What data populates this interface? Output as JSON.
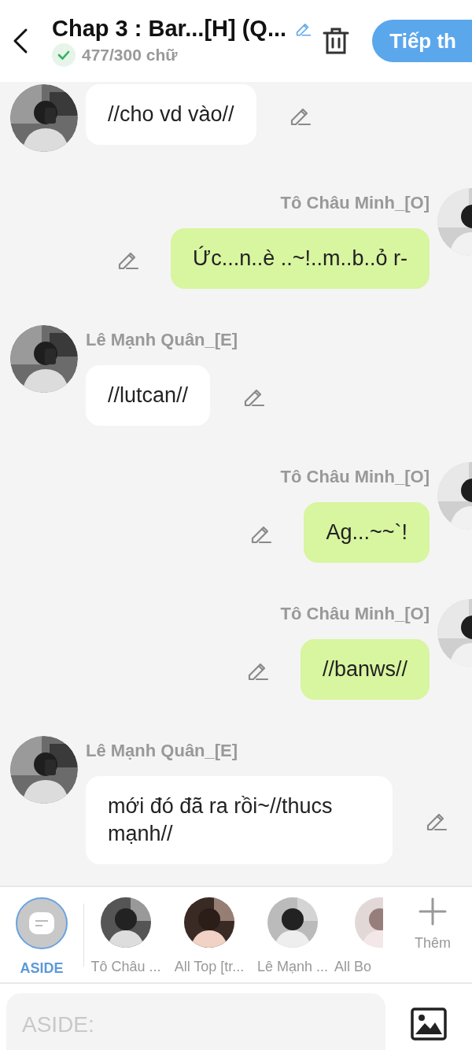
{
  "header": {
    "title": "Chap 3 : Bar...[H] (Q...",
    "word_count": "477/300 chữ",
    "next_button": "Tiếp th"
  },
  "messages": [
    {
      "kind": "incoming",
      "text": "//cho vd vào//"
    },
    {
      "kind": "outgoing",
      "name": "Tô Châu Minh_[O]",
      "text": "Ức...n..è ..~!..m..b..ỏ r-"
    },
    {
      "kind": "incoming",
      "name": "Lê Mạnh Quân_[E]",
      "text": "//lutcan//"
    },
    {
      "kind": "outgoing",
      "name": "Tô Châu Minh_[O]",
      "text": "Ag...~~`!"
    },
    {
      "kind": "outgoing",
      "name": "Tô Châu Minh_[O]",
      "text": "//banws//"
    },
    {
      "kind": "incoming",
      "name": "Lê Mạnh Quân_[E]",
      "text": "mới đó đã ra rồi~//thucs mạnh//"
    }
  ],
  "cast": [
    {
      "kind": "aside",
      "label": "ASIDE",
      "selected": true
    },
    {
      "kind": "character",
      "label": "Tô Châu ...",
      "selected": false
    },
    {
      "kind": "character",
      "label": "All Top [tr...",
      "selected": false
    },
    {
      "kind": "character",
      "label": "Lê Mạnh ...",
      "selected": false
    },
    {
      "kind": "character",
      "label": "All Bo",
      "selected": false
    }
  ],
  "add_button": "Thêm",
  "input": {
    "placeholder": "ASIDE:"
  }
}
